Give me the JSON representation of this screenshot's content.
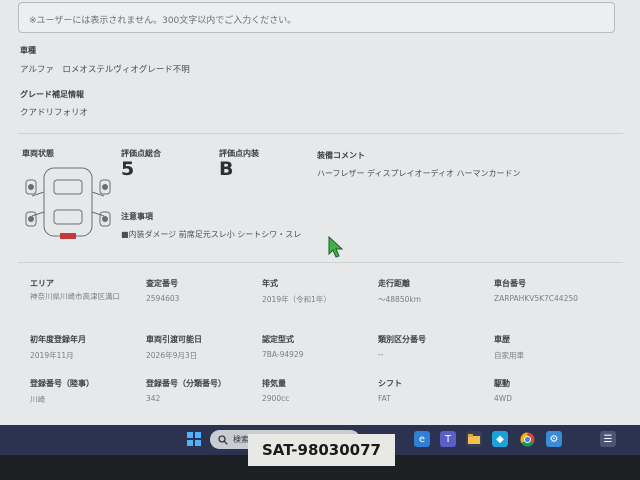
{
  "notice": "※ユーザーには表示されません。300文字以内でご入力ください。",
  "vehicle": {
    "model_label": "車種",
    "model_value": "アルファ　ロメオステルヴィオグレード不明",
    "grade_label": "グレード補足情報",
    "grade_value": "クアドリフォリオ"
  },
  "evaluation": {
    "condition_label": "車両状態",
    "overall_label": "評価点総合",
    "overall_value": "5",
    "interior_label": "評価点内装",
    "interior_value": "B",
    "equipment_label": "装備コメント",
    "equipment_value": "ハーフレザー ディスプレイオーディオ ハーマンカードン",
    "caution_label": "注意事項",
    "caution_value": "■内装ダメージ 前席足元スレ小 シートシワ・スレ"
  },
  "details": [
    {
      "label": "エリア",
      "value": "神奈川県川崎市高津区溝口"
    },
    {
      "label": "査定番号",
      "value": "2594603"
    },
    {
      "label": "年式",
      "value": "2019年（令和1年）"
    },
    {
      "label": "走行距離",
      "value": "～48850km"
    },
    {
      "label": "車台番号",
      "value": "ZARPAHKV5K7C44250"
    },
    {
      "label": "初年度登録年月",
      "value": "2019年11月"
    },
    {
      "label": "車両引渡可能日",
      "value": "2026年9月3日"
    },
    {
      "label": "認定型式",
      "value": "7BA-94929"
    },
    {
      "label": "類別区分番号",
      "value": "--"
    },
    {
      "label": "車歴",
      "value": "自家用車"
    },
    {
      "label": "登録番号（陸事）",
      "value": "川崎"
    },
    {
      "label": "登録番号（分類番号）",
      "value": "342"
    },
    {
      "label": "排気量",
      "value": "2900cc"
    },
    {
      "label": "シフト",
      "value": "FAT"
    },
    {
      "label": "駆動",
      "value": "4WD"
    }
  ],
  "taskbar": {
    "search_placeholder": "検索",
    "icons": [
      "windows-start-icon",
      "file-explorer-icon",
      "edge-icon",
      "teams-icon",
      "chrome-icon",
      "store-icon",
      "settings-icon"
    ],
    "accent": "#2b3350"
  },
  "stock_label": "SAT-98030077"
}
